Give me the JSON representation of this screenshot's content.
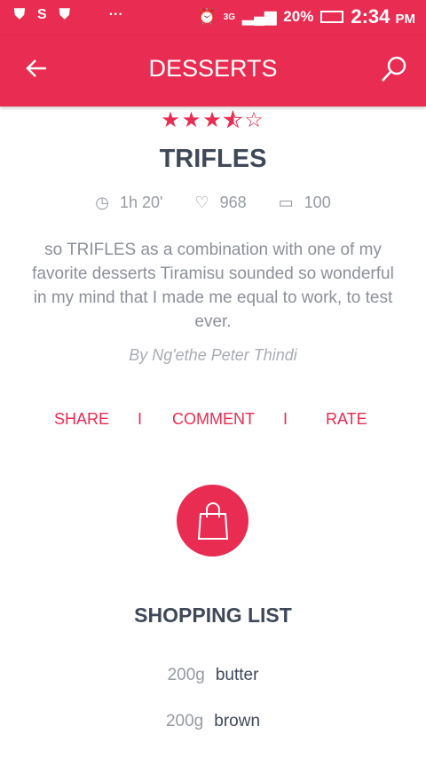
{
  "status": {
    "battery": "20%",
    "network": "3G",
    "time": "2:34",
    "ampm": "PM"
  },
  "appbar": {
    "title": "DESSERTS"
  },
  "recipe": {
    "rating": 3.5,
    "title": "TRIFLES",
    "time": "1h 20'",
    "likes": "968",
    "comments": "100",
    "description": "so TRIFLES as a combination with one of my favorite desserts Tiramisu sounded so wonderful in my mind that I made me equal to work, to test ever.",
    "author": "By Ng'ethe Peter Thindi"
  },
  "actions": {
    "share": "SHARE",
    "comment": "COMMENT",
    "rate": "RATE",
    "separator": "I"
  },
  "shopping": {
    "title": "SHOPPING LIST",
    "items": [
      {
        "qty": "200g",
        "name": "butter"
      },
      {
        "qty": "200g",
        "name": "brown"
      }
    ]
  },
  "colors": {
    "accent": "#e92c51",
    "text": "#3f4858"
  }
}
